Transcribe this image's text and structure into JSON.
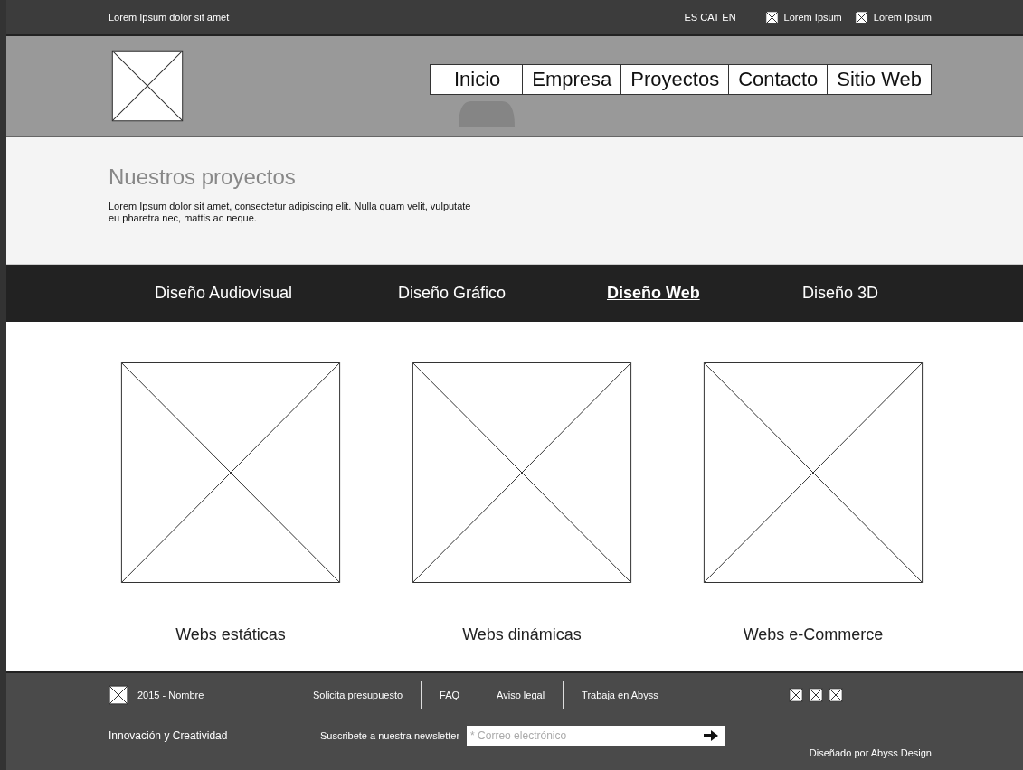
{
  "top_bar": {
    "tagline": "Lorem Ipsum dolor sit amet",
    "languages": "ES CAT EN",
    "links": [
      "Lorem Ipsum",
      "Lorem Ipsum"
    ]
  },
  "header": {
    "nav": [
      "Inicio",
      "Empresa",
      "Proyectos",
      "Contacto",
      "Sitio Web"
    ]
  },
  "intro": {
    "title": "Nuestros proyectos",
    "text": "Lorem Ipsum dolor sit amet, consectetur adipiscing elit. Nulla quam velit, vulputate eu pharetra nec, mattis ac neque."
  },
  "categories": [
    {
      "label": "Diseño Audiovisual",
      "selected": false
    },
    {
      "label": "Diseño Gráfico",
      "selected": false
    },
    {
      "label": "Diseño Web",
      "selected": true
    },
    {
      "label": "Diseño 3D",
      "selected": false
    }
  ],
  "projects": [
    {
      "caption": "Webs estáticas"
    },
    {
      "caption": "Webs dinámicas"
    },
    {
      "caption": "Webs e-Commerce"
    }
  ],
  "footer": {
    "copyright": "2015 - Nombre",
    "links": [
      "Solicita presupuesto",
      "FAQ",
      "Aviso legal",
      "Trabaja en Abyss"
    ],
    "slogan": "Innovación y Creatividad",
    "newsletter_label": "Suscribete a nuestra newsletter",
    "email": {
      "placeholder": "* Correo electrónico"
    },
    "credit": "Diseñado por Abyss Design"
  }
}
